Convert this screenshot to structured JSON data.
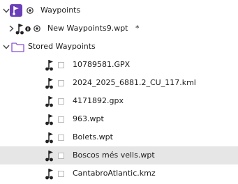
{
  "colors": {
    "accent": "#6b3fb8",
    "folder": "#8a4fd0",
    "selection": "#e6e6e6"
  },
  "root": {
    "label": "Waypoints",
    "icons": [
      "chevron-down-icon",
      "waypoints-app-icon",
      "visibility-eye-icon"
    ]
  },
  "file_group": {
    "label": "New Waypoints9.wpt",
    "modified_marker": "*",
    "icons": [
      "chevron-right-icon",
      "waypoint-flags-icon",
      "info-icon",
      "visibility-eye-icon"
    ]
  },
  "folder": {
    "label": "Stored Waypoints",
    "icons": [
      "chevron-down-icon",
      "folder-icon"
    ]
  },
  "files": [
    {
      "label": "10789581.GPX",
      "selected": false
    },
    {
      "label": "2024_2025_6881.2_CU_117.kml",
      "selected": false
    },
    {
      "label": "4171892.gpx",
      "selected": false
    },
    {
      "label": "963.wpt",
      "selected": false
    },
    {
      "label": "Bolets.wpt",
      "selected": false
    },
    {
      "label": "Boscos més vells.wpt",
      "selected": true
    },
    {
      "label": "CantabroAtlantic.kmz",
      "selected": false
    }
  ]
}
